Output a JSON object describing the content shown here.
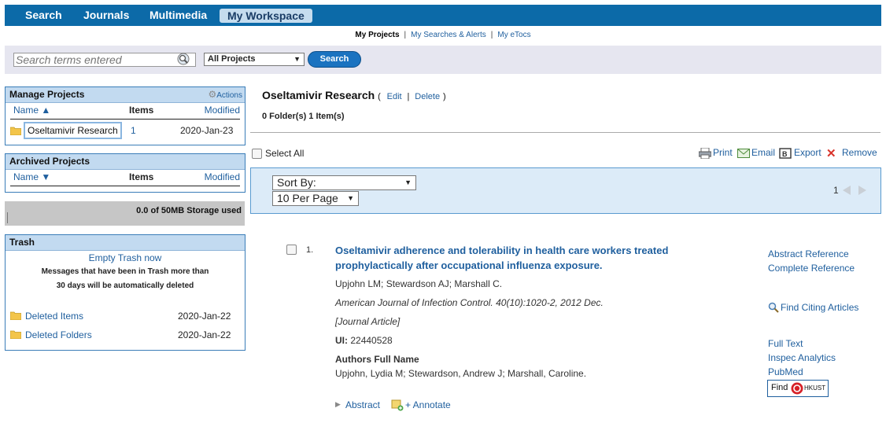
{
  "nav": {
    "items": [
      "Search",
      "Journals",
      "Multimedia"
    ],
    "active": "My Workspace"
  },
  "sublinks": {
    "current": "My Projects",
    "searches": "My Searches & Alerts",
    "etocs": "My eTocs",
    "sep": "|"
  },
  "search": {
    "placeholder": "Search terms entered",
    "scope": "All Projects",
    "button": "Search"
  },
  "manage": {
    "title": "Manage Projects",
    "actions": "Actions",
    "col_name": "Name ▲",
    "col_items": "Items",
    "col_modified": "Modified",
    "project_name": "Oseltamivir Research",
    "project_items": "1",
    "project_modified": "2020-Jan-23"
  },
  "archived": {
    "title": "Archived Projects",
    "col_name": "Name ▼",
    "col_items": "Items",
    "col_modified": "Modified"
  },
  "storage": {
    "text": "0.0 of 50MB Storage used"
  },
  "trash": {
    "title": "Trash",
    "empty": "Empty Trash now",
    "msg1": "Messages that have been in Trash more than",
    "msg2": "30 days will be automatically deleted",
    "deleted_items": "Deleted Items",
    "deleted_items_date": "2020-Jan-22",
    "deleted_folders": "Deleted Folders",
    "deleted_folders_date": "2020-Jan-22"
  },
  "project": {
    "title": "Oseltamivir Research",
    "paren_open": "(",
    "edit": "Edit",
    "sep": "|",
    "delete": "Delete",
    "paren_close": ")",
    "counts": "0 Folder(s) 1 Item(s)"
  },
  "toolbar": {
    "select_all": "Select All",
    "print": "Print",
    "email": "Email",
    "export": "Export",
    "remove": "Remove"
  },
  "sort": {
    "sort_by": "Sort By:",
    "per_page": "10 Per Page",
    "page": "1"
  },
  "result": {
    "num": "1.",
    "title": "Oseltamivir adherence and tolerability in health care workers treated prophylactically after occupational influenza exposure.",
    "authors": "Upjohn LM; Stewardson AJ; Marshall C.",
    "source": "American Journal of Infection Control. 40(10):1020-2, 2012 Dec.",
    "type": "[Journal Article]",
    "ui_label": "UI:",
    "ui_value": "22440528",
    "afn_label": "Authors Full Name",
    "afn_value": "Upjohn, Lydia M; Stewardson, Andrew J; Marshall, Caroline.",
    "abstract": "Abstract",
    "annotate": "+ Annotate"
  },
  "side_links": {
    "abstract_ref": "Abstract Reference",
    "complete_ref": "Complete Reference",
    "find_citing": "Find Citing Articles",
    "full_text": "Full Text",
    "inspec": "Inspec Analytics",
    "pubmed": "PubMed",
    "find": "Find",
    "hkust": "HKUST"
  }
}
